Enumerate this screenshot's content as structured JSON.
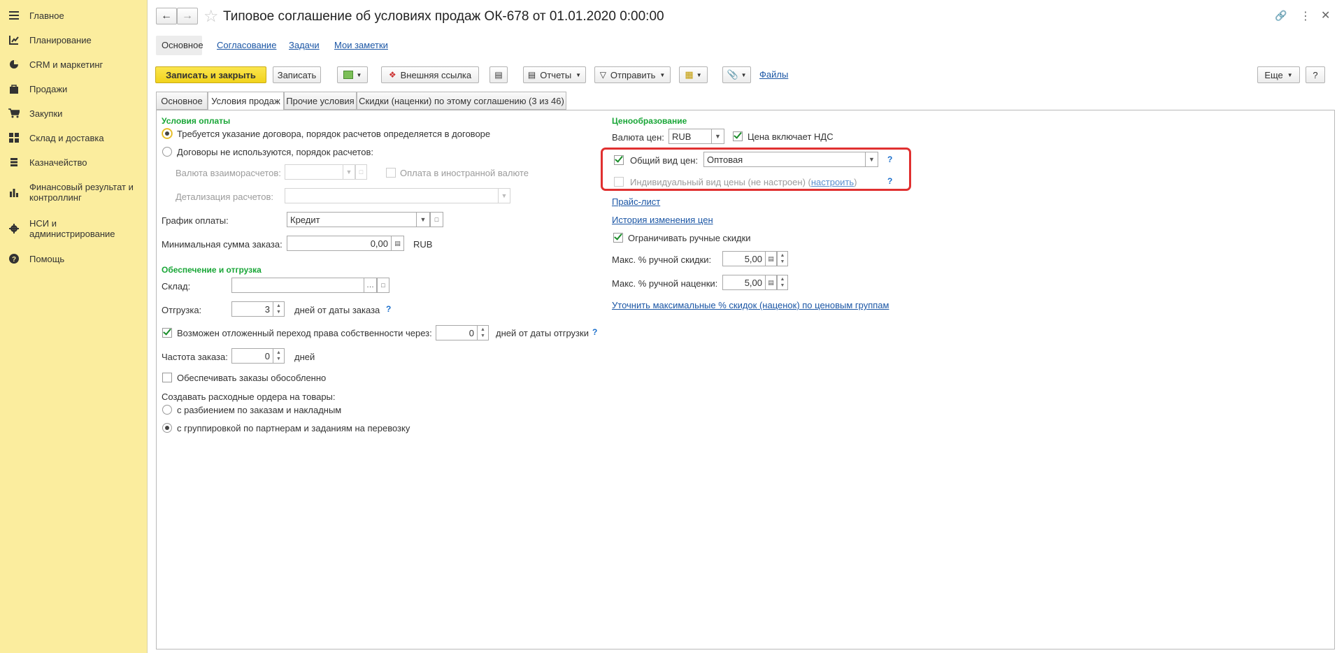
{
  "sidebar": {
    "items": [
      {
        "label": "Главное",
        "icon": "menu-icon"
      },
      {
        "label": "Планирование",
        "icon": "planning-icon"
      },
      {
        "label": "CRM и маркетинг",
        "icon": "pie-chart-icon"
      },
      {
        "label": "Продажи",
        "icon": "bag-icon"
      },
      {
        "label": "Закупки",
        "icon": "cart-icon"
      },
      {
        "label": "Склад и доставка",
        "icon": "warehouse-icon"
      },
      {
        "label": "Казначейство",
        "icon": "coins-icon"
      },
      {
        "label": "Финансовый результат и контроллинг",
        "icon": "bar-chart-icon"
      },
      {
        "label": "НСИ и администрирование",
        "icon": "gear-icon"
      },
      {
        "label": "Помощь",
        "icon": "help-icon"
      }
    ]
  },
  "window": {
    "title": "Типовое соглашение об условиях продаж ОК-678 от 01.01.2020 0:00:00",
    "nav_tabs": [
      "Основное",
      "Согласование",
      "Задачи",
      "Мои заметки"
    ]
  },
  "toolbar": {
    "save_close": "Записать и закрыть",
    "save": "Записать",
    "external_link": "Внешняя ссылка",
    "reports": "Отчеты",
    "send": "Отправить",
    "files": "Файлы",
    "more": "Еще",
    "help": "?"
  },
  "tabs": [
    "Основное",
    "Условия продаж",
    "Прочие условия",
    "Скидки (наценки) по этому соглашению (3 из 46)"
  ],
  "payment": {
    "header": "Условия оплаты",
    "radio1": "Требуется указание договора, порядок расчетов определяется в договоре",
    "radio2": "Договоры не используются, порядок расчетов:",
    "settlement_currency_label": "Валюта взаиморасчетов:",
    "foreign_currency_label": "Оплата в иностранной валюте",
    "detail_label": "Детализация расчетов:",
    "schedule_label": "График оплаты:",
    "schedule_value": "Кредит",
    "min_sum_label": "Минимальная сумма заказа:",
    "min_sum_value": "0,00",
    "min_sum_currency": "RUB"
  },
  "supply": {
    "header": "Обеспечение и отгрузка",
    "warehouse_label": "Склад:",
    "warehouse_value": "",
    "shipment_label": "Отгрузка:",
    "shipment_value": "3",
    "shipment_suffix": "дней от даты заказа",
    "deferred_label": "Возможен отложенный переход права собственности через:",
    "deferred_value": "0",
    "deferred_suffix": "дней от даты отгрузки",
    "frequency_label": "Частота заказа:",
    "frequency_value": "0",
    "frequency_suffix": "дней",
    "separate_label": "Обеспечивать заказы обособленно",
    "orders_header": "Создавать расходные ордера на товары:",
    "orders_radio1": "с разбиением по заказам и накладным",
    "orders_radio2": "с группировкой по партнерам и заданиям на перевозку"
  },
  "pricing": {
    "header": "Ценообразование",
    "currency_label": "Валюта цен:",
    "currency_value": "RUB",
    "vat_label": "Цена включает НДС",
    "general_price_label": "Общий вид цен:",
    "general_price_value": "Оптовая",
    "individual_label": "Индивидуальный вид цены (не настроен) (",
    "individual_link": "настроить",
    "individual_close": ")",
    "price_list_link": "Прайс-лист",
    "history_link": "История изменения цен",
    "limit_label": "Ограничивать ручные скидки",
    "max_discount_label": "Макс. % ручной скидки:",
    "max_discount_value": "5,00",
    "max_markup_label": "Макс. % ручной наценки:",
    "max_markup_value": "5,00",
    "refine_link": "Уточнить максимальные % скидок (наценок) по ценовым группам"
  },
  "colors": {
    "sidebar_bg": "#fbed9e",
    "accent_yellow": "#f1d31c",
    "section_green": "#19a637",
    "highlight_red": "#e03030",
    "link_blue": "#1b56a5"
  }
}
